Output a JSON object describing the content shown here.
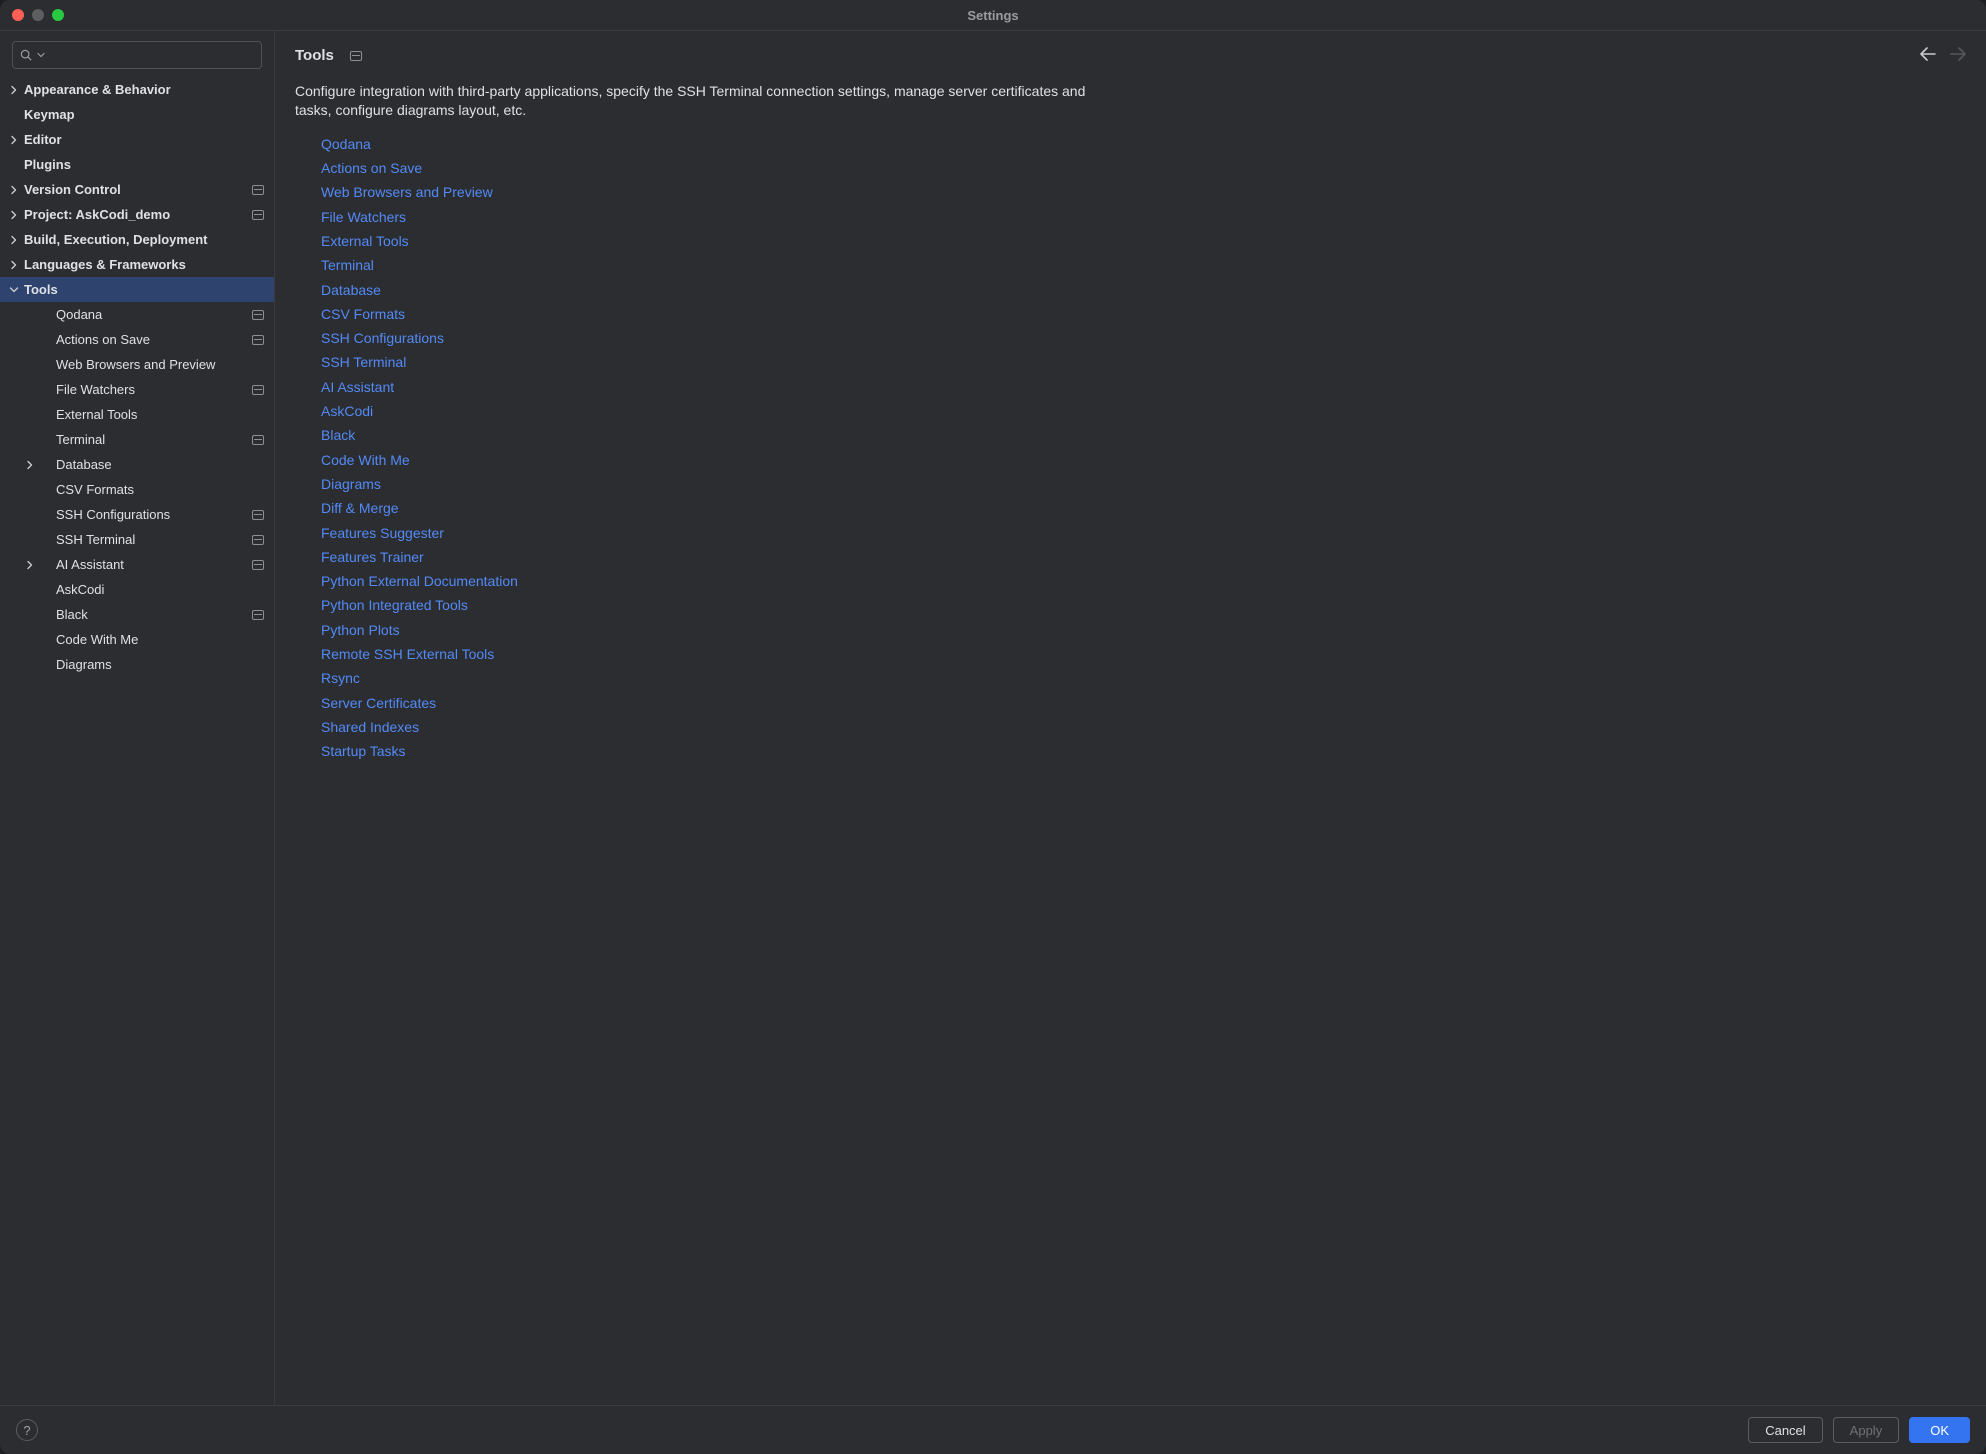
{
  "window": {
    "title": "Settings"
  },
  "search": {
    "placeholder": ""
  },
  "sidebar": {
    "sections": [
      {
        "label": "Appearance & Behavior",
        "bold": true,
        "expandable": true,
        "expanded": false,
        "depth": 0
      },
      {
        "label": "Keymap",
        "bold": true,
        "expandable": false,
        "depth": 0
      },
      {
        "label": "Editor",
        "bold": true,
        "expandable": true,
        "expanded": false,
        "depth": 0
      },
      {
        "label": "Plugins",
        "bold": true,
        "expandable": false,
        "depth": 0
      },
      {
        "label": "Version Control",
        "bold": true,
        "expandable": true,
        "expanded": false,
        "depth": 0,
        "badge": true
      },
      {
        "label": "Project: AskCodi_demo",
        "bold": true,
        "expandable": true,
        "expanded": false,
        "depth": 0,
        "badge": true
      },
      {
        "label": "Build, Execution, Deployment",
        "bold": true,
        "expandable": true,
        "expanded": false,
        "depth": 0
      },
      {
        "label": "Languages & Frameworks",
        "bold": true,
        "expandable": true,
        "expanded": false,
        "depth": 0
      },
      {
        "label": "Tools",
        "bold": true,
        "expandable": true,
        "expanded": true,
        "depth": 0,
        "selected": true
      },
      {
        "label": "Qodana",
        "depth": 1,
        "expandable": false,
        "badge": true
      },
      {
        "label": "Actions on Save",
        "depth": 1,
        "expandable": false,
        "badge": true
      },
      {
        "label": "Web Browsers and Preview",
        "depth": 1,
        "expandable": false
      },
      {
        "label": "File Watchers",
        "depth": 1,
        "expandable": false,
        "badge": true
      },
      {
        "label": "External Tools",
        "depth": 1,
        "expandable": false
      },
      {
        "label": "Terminal",
        "depth": 1,
        "expandable": false,
        "badge": true
      },
      {
        "label": "Database",
        "depth": 1,
        "expandable": true,
        "expanded": false
      },
      {
        "label": "CSV Formats",
        "depth": 1,
        "expandable": false
      },
      {
        "label": "SSH Configurations",
        "depth": 1,
        "expandable": false,
        "badge": true
      },
      {
        "label": "SSH Terminal",
        "depth": 1,
        "expandable": false,
        "badge": true
      },
      {
        "label": "AI Assistant",
        "depth": 1,
        "expandable": true,
        "expanded": false,
        "badge": true
      },
      {
        "label": "AskCodi",
        "depth": 1,
        "expandable": false
      },
      {
        "label": "Black",
        "depth": 1,
        "expandable": false,
        "badge": true
      },
      {
        "label": "Code With Me",
        "depth": 1,
        "expandable": false
      },
      {
        "label": "Diagrams",
        "depth": 1,
        "expandable": false
      }
    ]
  },
  "content": {
    "title": "Tools",
    "badge": true,
    "description": "Configure integration with third-party applications, specify the SSH Terminal connection settings, manage server certificates and tasks, configure diagrams layout, etc.",
    "links": [
      "Qodana",
      "Actions on Save",
      "Web Browsers and Preview",
      "File Watchers",
      "External Tools",
      "Terminal",
      "Database",
      "CSV Formats",
      "SSH Configurations",
      "SSH Terminal",
      "AI Assistant",
      "AskCodi",
      "Black",
      "Code With Me",
      "Diagrams",
      "Diff & Merge",
      "Features Suggester",
      "Features Trainer",
      "Python External Documentation",
      "Python Integrated Tools",
      "Python Plots",
      "Remote SSH External Tools",
      "Rsync",
      "Server Certificates",
      "Shared Indexes",
      "Startup Tasks"
    ]
  },
  "footer": {
    "cancel": "Cancel",
    "apply": "Apply",
    "ok": "OK"
  }
}
